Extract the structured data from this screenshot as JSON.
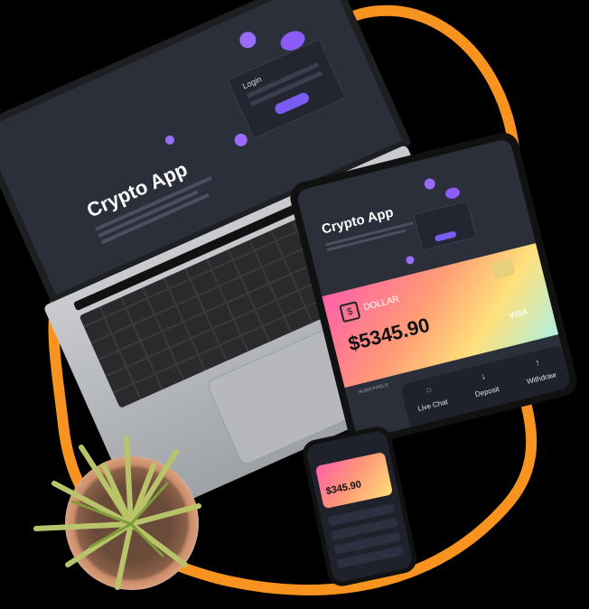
{
  "scene": {
    "accent_orange": "#f7931e",
    "background": "#000000"
  },
  "laptop_screen": {
    "title": "Crypto App",
    "login_label": "Login"
  },
  "tablet_screen": {
    "title": "Crypto App",
    "currency": "DOLLAR",
    "currency_icon": "$",
    "balance": "$5345.90",
    "card_brand": "VISA",
    "card_holder": "ALIEN PIXELS",
    "actions": [
      {
        "label": "Live Chat",
        "icon": "chat-icon",
        "glyph": "◌"
      },
      {
        "label": "Deposit",
        "icon": "arrow-down-icon",
        "glyph": "↓"
      },
      {
        "label": "Withdraw",
        "icon": "arrow-up-icon",
        "glyph": "↑"
      }
    ]
  },
  "phone_screen": {
    "balance": "$345.90"
  }
}
